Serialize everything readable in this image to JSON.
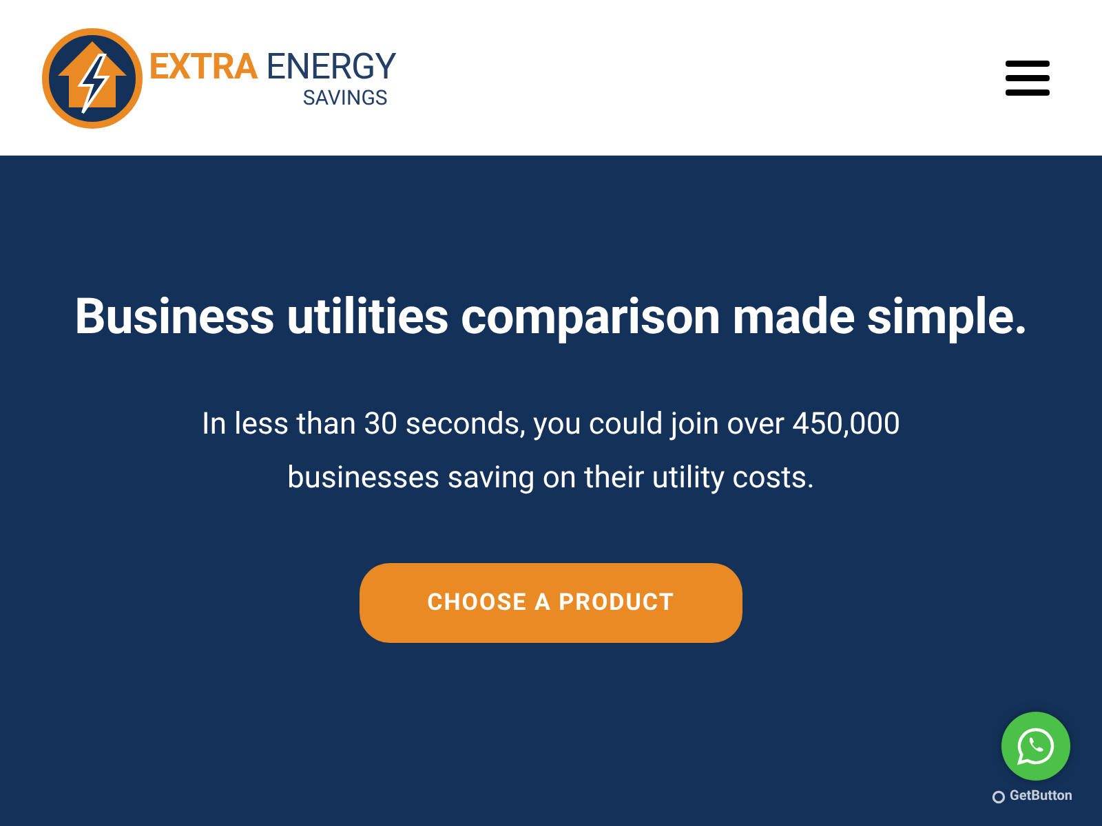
{
  "header": {
    "logo": {
      "word_1": "EXTRA",
      "word_2": "ENERGY",
      "word_3": "SAVINGS"
    }
  },
  "hero": {
    "heading": "Business utilities comparison made simple.",
    "text": "In less than 30 seconds, you could join over 450,000 businesses saving on their utility costs.",
    "button": "CHOOSE A PRODUCT"
  },
  "chat_widget": {
    "credit": "GetButton"
  }
}
